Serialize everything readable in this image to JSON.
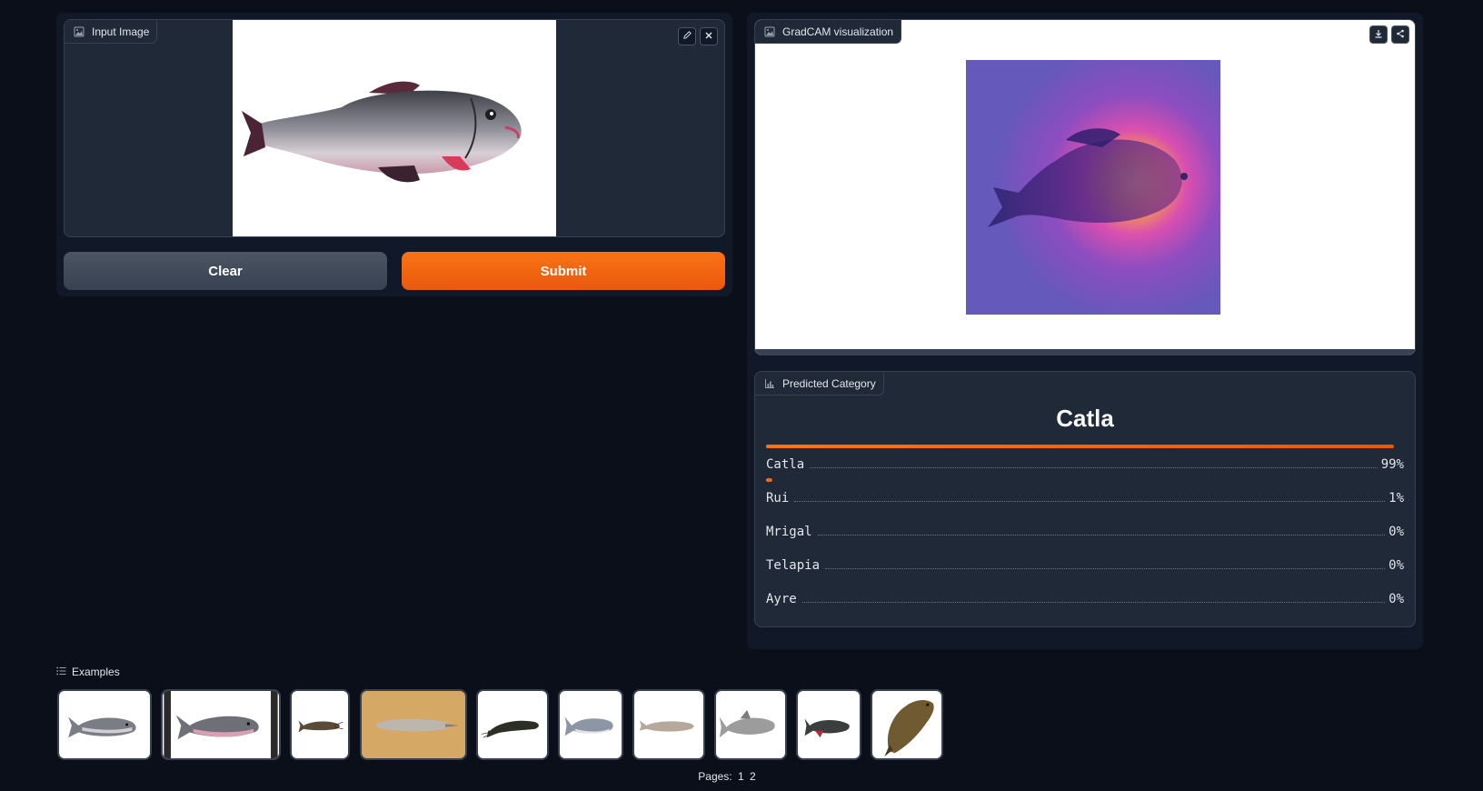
{
  "input_panel": {
    "label": "Input Image",
    "icon": "image-icon",
    "clear_label": "Clear",
    "submit_label": "Submit"
  },
  "gradcam_panel": {
    "label": "GradCAM visualization",
    "icon": "image-icon"
  },
  "prediction_panel": {
    "label": "Predicted Category",
    "icon": "bar-chart-icon",
    "top_label": "Catla",
    "classes": [
      {
        "name": "Catla",
        "percent": "99%",
        "confidence": 0.99
      },
      {
        "name": "Rui",
        "percent": "1%",
        "confidence": 0.01
      },
      {
        "name": "Mrigal",
        "percent": "0%",
        "confidence": 0.0
      },
      {
        "name": "Telapia",
        "percent": "0%",
        "confidence": 0.0
      },
      {
        "name": "Ayre",
        "percent": "0%",
        "confidence": 0.0
      }
    ]
  },
  "examples": {
    "label": "Examples",
    "icon": "list-icon",
    "pages_label": "Pages:",
    "pages": [
      "1",
      "2"
    ]
  },
  "colors": {
    "accent": "#ea580c",
    "background": "#0b0f19",
    "panel": "#111827",
    "block": "#1f2937"
  }
}
